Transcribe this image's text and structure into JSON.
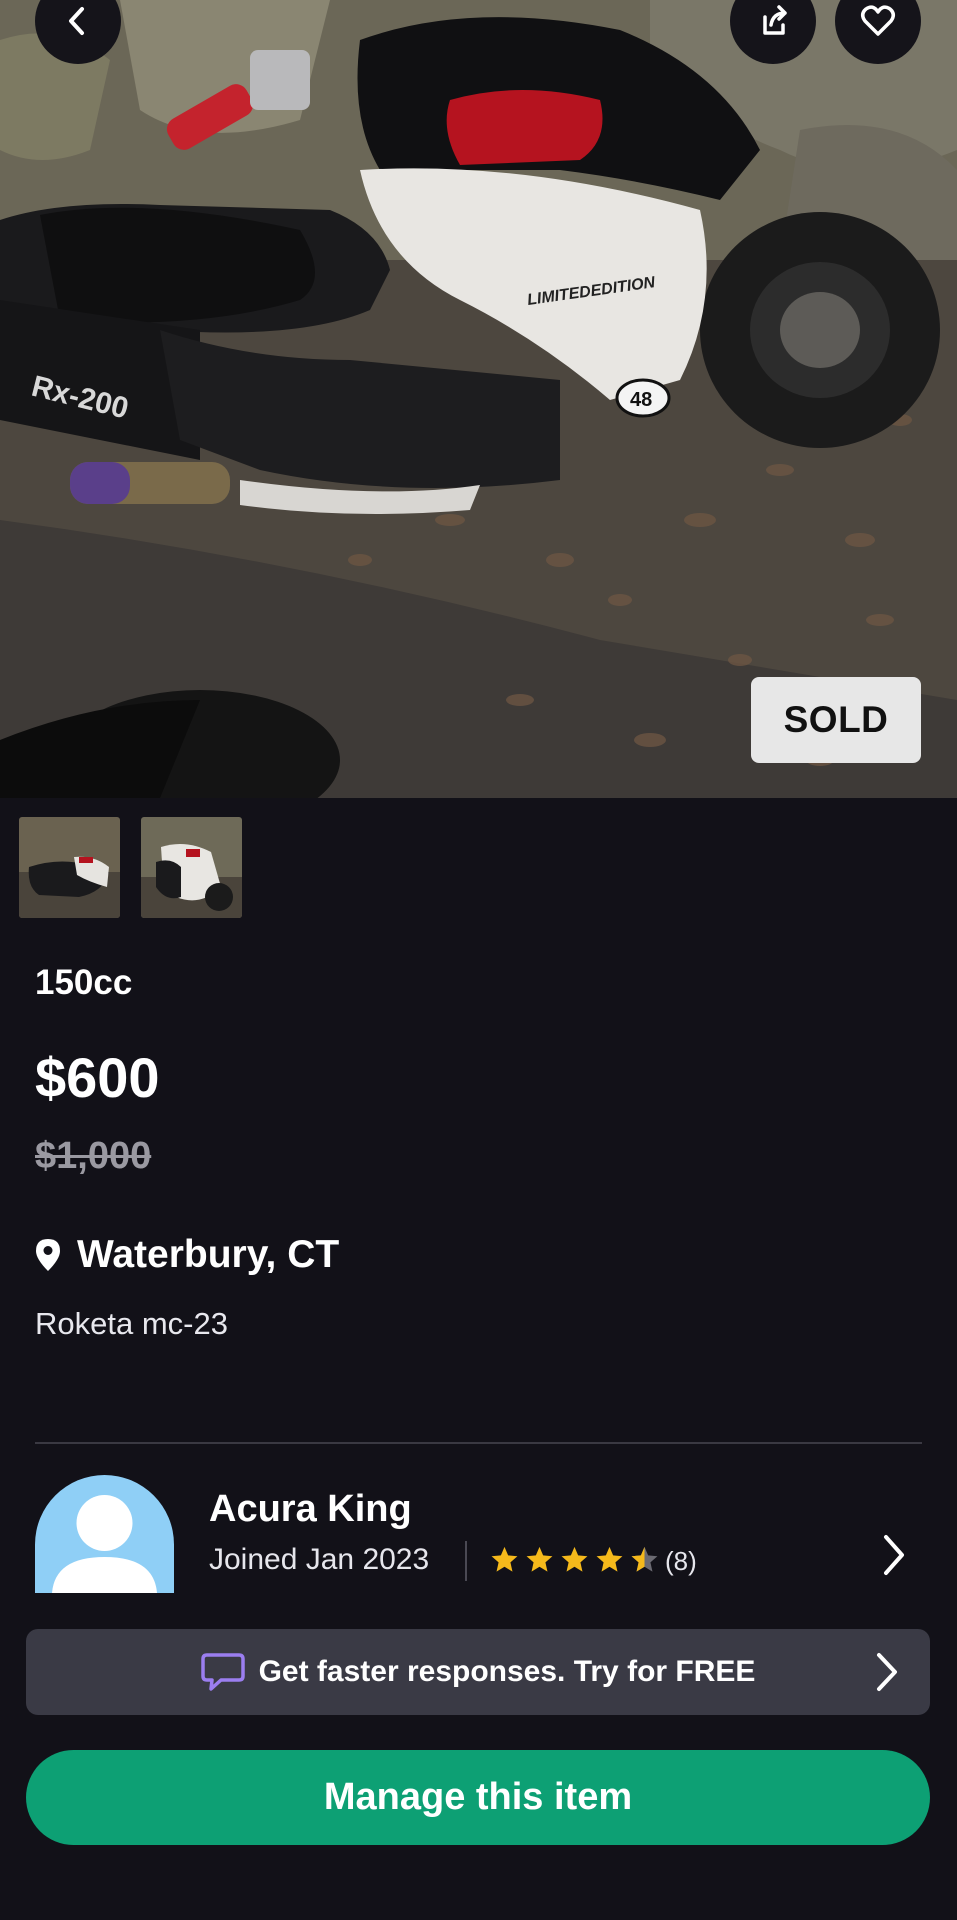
{
  "listing": {
    "status_badge": "SOLD",
    "title": "150cc",
    "price": "$600",
    "original_price": "$1,000",
    "location": "Waterbury, CT",
    "description": "Roketa mc-23",
    "thumbnails": [
      "scooter-photo-1",
      "scooter-photo-2"
    ]
  },
  "seller": {
    "name": "Acura King",
    "joined": "Joined Jan 2023",
    "rating": 4.5,
    "rating_count": "(8)"
  },
  "promo": {
    "text": "Get faster responses.  Try for FREE"
  },
  "actions": {
    "manage_label": "Manage this item"
  },
  "icons": {
    "back": "chevron-left-icon",
    "share": "share-icon",
    "favorite": "heart-icon",
    "location": "map-pin-icon",
    "chat": "chat-bubble-icon"
  },
  "colors": {
    "background": "#121118",
    "accent_green": "#0da074",
    "star": "#f5b91b",
    "avatar_bg": "#8fcff6",
    "promo_bg": "#3a3a45",
    "chat_icon": "#9b7ef0"
  }
}
